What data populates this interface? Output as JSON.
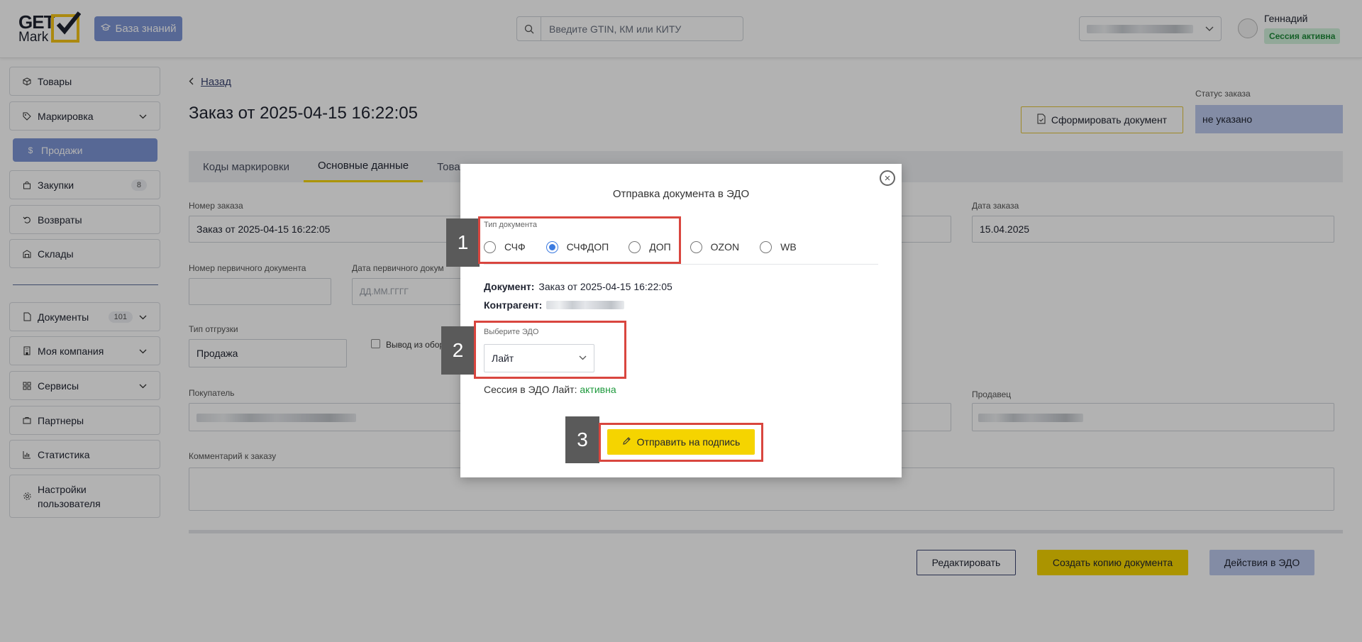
{
  "header": {
    "logo_top": "GET",
    "logo_bottom": "Mark",
    "kb_button": "База знаний",
    "search_placeholder": "Введите GTIN, КМ или КИТУ",
    "user_name": "Геннадий",
    "session_status": "Сессия активна"
  },
  "sidebar": {
    "items": [
      {
        "label": "Товары"
      },
      {
        "label": "Маркировка"
      },
      {
        "label": "Продажи"
      },
      {
        "label": "Закупки",
        "count": "8"
      },
      {
        "label": "Возвраты"
      },
      {
        "label": "Склады"
      },
      {
        "label": "Документы",
        "count": "101"
      },
      {
        "label": "Моя компания"
      },
      {
        "label": "Сервисы"
      },
      {
        "label": "Партнеры"
      },
      {
        "label": "Статистика"
      },
      {
        "label": "Настройки пользователя"
      }
    ]
  },
  "main": {
    "back": "Назад",
    "title": "Заказ от 2025-04-15 16:22:05",
    "form_doc_button": "Сформировать документ",
    "status_label": "Статус заказа",
    "status_value": "не указано",
    "tabs": [
      "Коды маркировки",
      "Основные данные",
      "Товары"
    ],
    "order_number_label": "Номер заказа",
    "order_number_value": "Заказ от 2025-04-15 16:22:05",
    "order_date_label": "Дата заказа",
    "order_date_value": "15.04.2025",
    "primary_doc_number_label": "Номер первичного документа",
    "primary_doc_date_label": "Дата первичного докум",
    "primary_doc_date_placeholder": "ДД.ММ.ГГГГ",
    "shipment_type_label": "Тип отгрузки",
    "shipment_type_value": "Продажа",
    "withdraw_label": "Вывод из обор",
    "buyer_label": "Покупатель",
    "seller_label": "Продавец",
    "comment_label": "Комментарий к заказу",
    "btn_edit": "Редактировать",
    "btn_copy": "Создать копию документа",
    "btn_edo": "Действия в ЭДО"
  },
  "modal": {
    "title": "Отправка документа в ЭДО",
    "doctype_label": "Тип документа",
    "doctypes": [
      "СЧФ",
      "СЧФДОП",
      "ДОП",
      "OZON",
      "WB"
    ],
    "doctype_selected": "СЧФДОП",
    "document_label": "Документ:",
    "document_value": "Заказ от 2025-04-15 16:22:05",
    "counterparty_label": "Контрагент:",
    "edo_label": "Выберите ЭДО",
    "edo_value": "Лайт",
    "session_text": "Сессия в ЭДО Лайт:",
    "session_status": "активна",
    "sign_button": "Отправить на подпись"
  },
  "annotations": [
    "1",
    "2",
    "3"
  ],
  "colors": {
    "accent_blue": "#7d95d6",
    "accent_yellow": "#f5d400",
    "annotation_red": "#d9463f",
    "session_green": "#1f9a3e"
  }
}
